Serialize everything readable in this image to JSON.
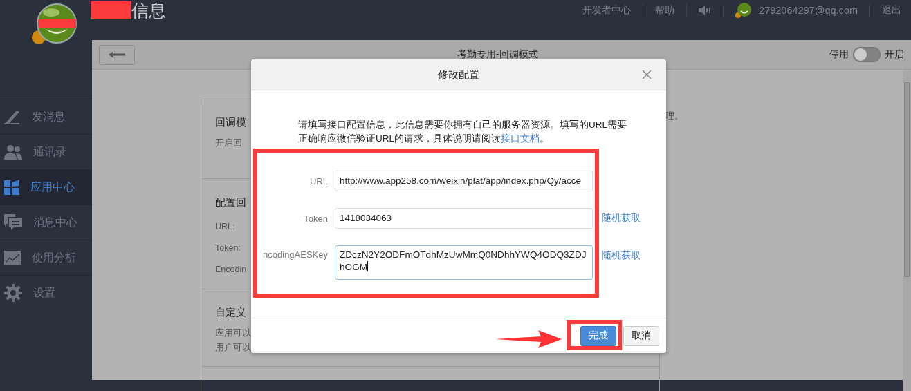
{
  "header": {
    "title": "信息",
    "nav": [
      {
        "kind": "text",
        "label": "开发者中心"
      },
      {
        "kind": "text",
        "label": "帮助"
      },
      {
        "kind": "sound"
      },
      {
        "kind": "user",
        "label": "2792064297@qq.com"
      },
      {
        "kind": "text",
        "label": "退出"
      }
    ]
  },
  "sidebar": {
    "items": [
      {
        "kind": "pencil",
        "label": "发消息",
        "selected": false
      },
      {
        "kind": "people",
        "label": "通讯录",
        "selected": false
      },
      {
        "kind": "apps",
        "label": "应用中心",
        "selected": true
      },
      {
        "kind": "chat",
        "label": "消息中心",
        "selected": false
      },
      {
        "kind": "chart",
        "label": "使用分析",
        "selected": false
      },
      {
        "kind": "gear",
        "label": "设置",
        "selected": false
      }
    ]
  },
  "page": {
    "title": "考勤专用-回调模式",
    "toggle": {
      "off_label": "停用",
      "on_label": "开启",
      "on": false
    },
    "sections": [
      {
        "title": "回调模",
        "lines": [
          "开启回"
        ]
      },
      {
        "title": "配置回",
        "lines": [
          "URL:",
          "Token:",
          "Encodin"
        ]
      },
      {
        "title": "自定义",
        "lines": [
          "应用可以",
          "用户可以"
        ]
      }
    ],
    "side_note": "理。"
  },
  "dialog": {
    "title": "修改配置",
    "description": "请填写接口配置信息，此信息需要你拥有自己的服务器资源。填写的URL需要正确响应微信验证URL的请求，具体说明请阅读",
    "doc_link": "接口文档",
    "description_end": "。",
    "fields": [
      {
        "kind": "input",
        "label": "URL",
        "value": "http://www.app258.com/weixin/plat/app/index.php/Qy/acce"
      },
      {
        "kind": "input",
        "label": "Token",
        "value": "1418034063",
        "action": "随机获取"
      },
      {
        "kind": "textarea",
        "label": "ncodingAESKey",
        "value": "ZDczN2Y2ODFmOTdhMzUwMmQ0NDhhYWQ4ODQ3ZDJhOGM",
        "action": "随机获取",
        "focused": true
      }
    ],
    "buttons": [
      {
        "kind": "primary",
        "label": "完成"
      },
      {
        "kind": "secondary",
        "label": "取消"
      }
    ]
  }
}
